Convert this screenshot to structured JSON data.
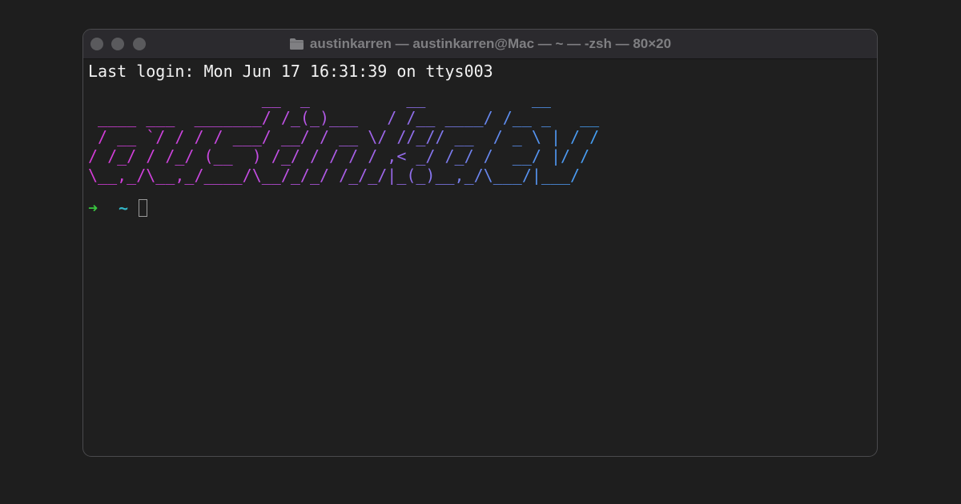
{
  "window": {
    "title": "austinkarren — austinkarren@Mac — ~ — -zsh — 80×20",
    "title_icon": "folder-icon"
  },
  "terminal": {
    "last_login": "Last login: Mon Jun 17 16:31:39 on ttys003",
    "banner": [
      "                  __  _          __           __",
      " ____ ___  _______/ /_(_)___   / /__ ____/ /__ _   __",
      " / __ `/ / / / ___/ __/ / __ \\/ //_// __  / _ \\ | / /",
      "/ /_/ / /_/ (__  ) /_/ / / / / ,< _/ /_/ /  __/ |/ /",
      "\\__,_/\\__,_/____/\\__/_/_/ /_/_/|_(_)__,_/\\___/|___/"
    ],
    "prompt_symbol": "➜",
    "prompt_dir": "~"
  },
  "colors": {
    "background": "#1e1e1e",
    "prompt_arrow": "#39c53f",
    "prompt_dir": "#33b7c8",
    "banner_gradient_start": "#d63bd8",
    "banner_gradient_end": "#3fa3f3"
  }
}
